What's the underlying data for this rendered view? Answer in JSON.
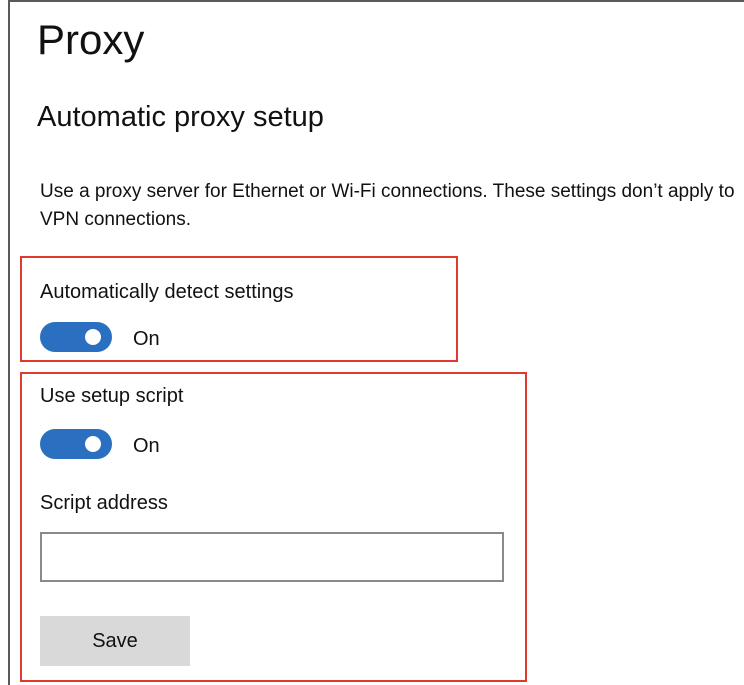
{
  "page": {
    "title": "Proxy"
  },
  "automatic_proxy": {
    "section_title": "Automatic proxy setup",
    "description": "Use a proxy server for Ethernet or Wi-Fi connections. These settings don’t apply to VPN connections.",
    "auto_detect": {
      "label": "Automatically detect settings",
      "state_label": "On",
      "enabled": true
    },
    "setup_script": {
      "label": "Use setup script",
      "state_label": "On",
      "enabled": true
    },
    "script_address": {
      "label": "Script address",
      "value": "",
      "placeholder": ""
    },
    "save_label": "Save"
  },
  "colors": {
    "toggle_on": "#2a6fc0",
    "highlight": "#e03a2f",
    "button_bg": "#d9d9d9"
  }
}
